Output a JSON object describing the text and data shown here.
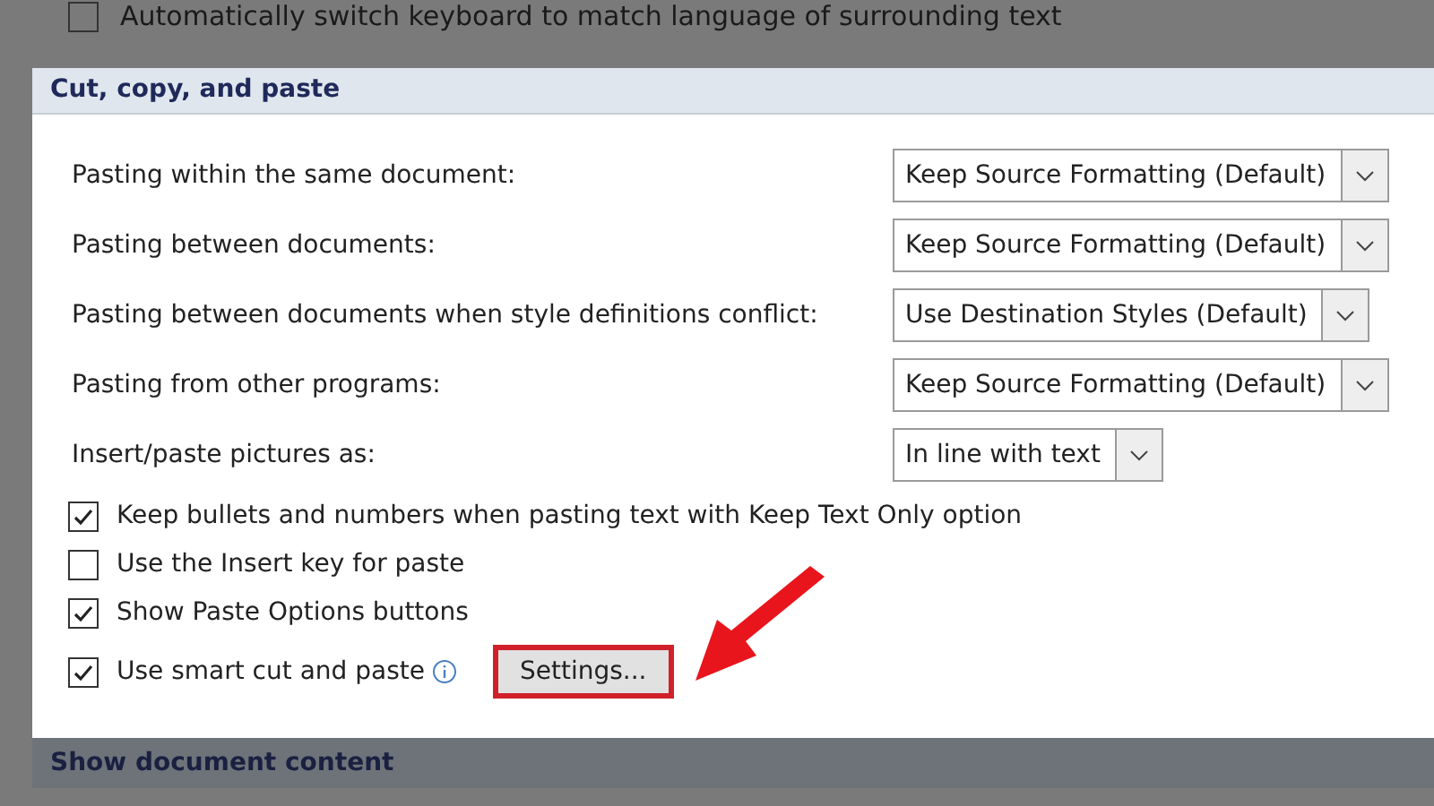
{
  "background_option": {
    "label": "Automatically switch keyboard to match language of surrounding text",
    "checked": false
  },
  "section": {
    "title": "Cut, copy, and paste",
    "dropdowns": [
      {
        "label": "Pasting within the same document:",
        "value": "Keep Source Formatting (Default)"
      },
      {
        "label": "Pasting between documents:",
        "value": "Keep Source Formatting (Default)"
      },
      {
        "label": "Pasting between documents when style definitions conflict:",
        "value": "Use Destination Styles (Default)"
      },
      {
        "label": "Pasting from other programs:",
        "value": "Keep Source Formatting (Default)"
      },
      {
        "label": "Insert/paste pictures as:",
        "value": "In line with text"
      }
    ],
    "checkboxes": [
      {
        "label": "Keep bullets and numbers when pasting text with Keep Text Only option",
        "checked": true
      },
      {
        "label": "Use the Insert key for paste",
        "checked": false
      },
      {
        "label": "Show Paste Options buttons",
        "checked": true
      },
      {
        "label": "Use smart cut and paste",
        "checked": true,
        "info": true,
        "button": "Settings..."
      }
    ]
  },
  "next_section": {
    "title": "Show document content"
  }
}
